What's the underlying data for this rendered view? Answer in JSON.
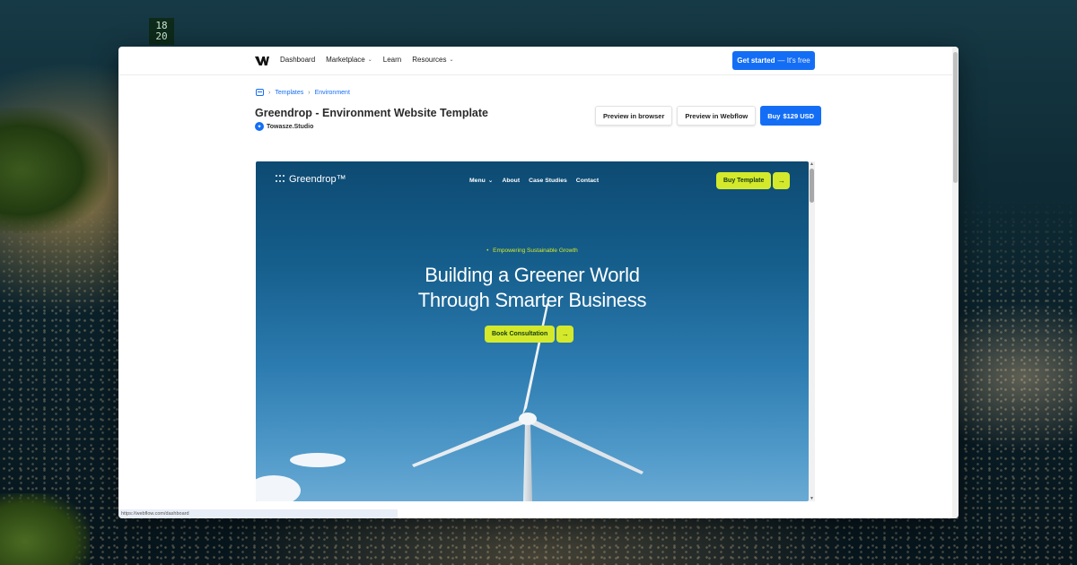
{
  "desktop": {
    "clock_sign": "18 20"
  },
  "nav": {
    "links": [
      {
        "label": "Dashboard",
        "has_caret": false
      },
      {
        "label": "Marketplace",
        "has_caret": true
      },
      {
        "label": "Learn",
        "has_caret": false
      },
      {
        "label": "Resources",
        "has_caret": true
      }
    ],
    "cta_label": "Get started",
    "cta_suffix": "— It's free"
  },
  "breadcrumb": {
    "items": [
      "Templates",
      "Environment"
    ]
  },
  "template": {
    "title": "Greendrop - Environment Website Template",
    "author": "Towasze.Studio",
    "preview_browser_label": "Preview in browser",
    "preview_webflow_label": "Preview in Webflow",
    "buy_label": "Buy",
    "buy_price": "$129 USD"
  },
  "preview_site": {
    "logo_text": "Greendrop™",
    "nav_links": [
      {
        "label": "Menu",
        "has_caret": true
      },
      {
        "label": "About",
        "has_caret": false
      },
      {
        "label": "Case Studies",
        "has_caret": false
      },
      {
        "label": "Contact",
        "has_caret": false
      }
    ],
    "buy_template_label": "Buy Template",
    "eyebrow": "Empowering Sustainable Growth",
    "headline_line1": "Building a Greener World",
    "headline_line2": "Through Smarter Business",
    "cta_label": "Book Consultation",
    "arrow": "→"
  },
  "status_bar": {
    "url": "https://webflow.com/dashboard"
  },
  "colors": {
    "webflow_blue": "#146ef5",
    "greendrop_lime": "#d4e92b",
    "greendrop_navy": "#0d4a72"
  }
}
